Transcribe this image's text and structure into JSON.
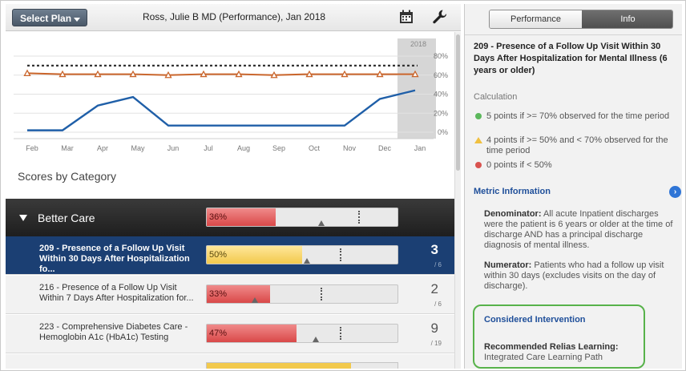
{
  "toolbar": {
    "select_plan_label": "Select Plan",
    "title": "Ross, Julie B MD (Performance), Jan 2018",
    "icons": [
      "calendar-icon",
      "wrench-icon"
    ]
  },
  "chart_data": {
    "type": "line",
    "categories": [
      "Feb",
      "Mar",
      "Apr",
      "May",
      "Jun",
      "Jul",
      "Aug",
      "Sep",
      "Oct",
      "Nov",
      "Dec",
      "Jan"
    ],
    "year_label": "2018",
    "yticks": [
      "80%",
      "60%",
      "40%",
      "20%",
      "0%"
    ],
    "ylim": [
      0,
      80
    ],
    "series": [
      {
        "color": "#1f5fa8",
        "values": [
          2,
          2,
          28,
          37,
          7,
          7,
          7,
          7,
          7,
          7,
          35,
          44
        ]
      },
      {
        "color": "#c9642a",
        "values": [
          62,
          61,
          61,
          61,
          60,
          61,
          61,
          60,
          61,
          61,
          61,
          61
        ]
      }
    ],
    "target_value": 70,
    "target_color": "#333333",
    "highlight_band": "Jan"
  },
  "scores": {
    "title": "Scores by Category",
    "category": {
      "name": "Better Care",
      "pct_label": "36%",
      "value": 36
    },
    "rows": [
      {
        "title": "209 - Presence of a Follow Up Visit Within 30 Days After Hospitalization fo...",
        "pct_label": "50%",
        "value": 50,
        "color": "yellow",
        "score": "3",
        "out_of": "/ 6",
        "selected": true
      },
      {
        "title": "216 - Presence of a Follow Up Visit Within 7 Days After Hospitalization for...",
        "pct_label": "33%",
        "value": 33,
        "color": "red",
        "score": "2",
        "out_of": "/ 6",
        "selected": false
      },
      {
        "title": "223 - Comprehensive Diabetes Care - Hemoglobin A1c (HbA1c) Testing",
        "pct_label": "47%",
        "value": 47,
        "color": "red",
        "score": "9",
        "out_of": "/ 19",
        "selected": false
      }
    ]
  },
  "info_panel": {
    "tabs": {
      "performance": "Performance",
      "info": "Info"
    },
    "metric_title": "209 - Presence of a Follow Up Visit Within 30 Days After Hospitalization for Mental Illness (6 years or older)",
    "calculation_label": "Calculation",
    "calculation": [
      {
        "text": "5 points if >= 70% observed for the time period",
        "color": "#5cb85c",
        "shape": "circle"
      },
      {
        "text": "4 points if >= 50% and < 70% observed for the time period",
        "color": "#f0c040",
        "shape": "triangle"
      },
      {
        "text": "0 points if < 50%",
        "color": "#d9534f",
        "shape": "circle"
      }
    ],
    "metric_information_label": "Metric Information",
    "denominator_label": "Denominator:",
    "denominator_text": "All acute Inpatient discharges were the patient is 6 years or older at the time of discharge AND has a principal discharge diagnosis of mental illness.",
    "numerator_label": "Numerator:",
    "numerator_text": "Patients who had a follow up visit within 30 days (excludes visits on the day of discharge).",
    "intervention": {
      "title": "Considered Intervention",
      "label": "Recommended Relias Learning:",
      "value": "Integrated Care Learning Path"
    }
  }
}
